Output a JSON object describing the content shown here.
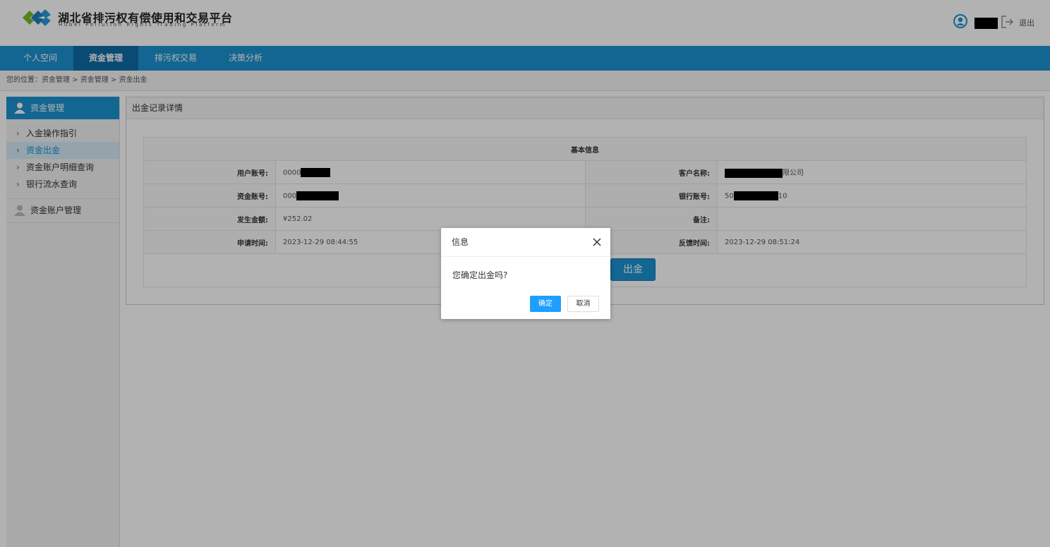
{
  "header": {
    "brand_cn": "湖北省排污权有偿使用和交易平台",
    "brand_en": "Hubei Pollution Rights Trading Platform",
    "logout": "退出"
  },
  "nav": {
    "items": [
      {
        "label": "个人空间"
      },
      {
        "label": "资金管理"
      },
      {
        "label": "排污权交易"
      },
      {
        "label": "决策分析"
      }
    ],
    "active": "资金管理"
  },
  "breadcrumb": {
    "prefix": "您的位置：",
    "path": "资金管理 > 资金管理 > 资金出金"
  },
  "sidebar": {
    "header": "资金管理",
    "items": [
      {
        "label": "入金操作指引"
      },
      {
        "label": "资金出金"
      },
      {
        "label": "资金账户明细查询"
      },
      {
        "label": "银行流水查询"
      }
    ],
    "group2": "资金账户管理"
  },
  "panel": {
    "title": "出金记录详情",
    "section": "基本信息",
    "rows": [
      {
        "k1": "用户账号:",
        "v1_prefix": "0000",
        "k2": "客户名称:",
        "v2_prefix": "",
        "v2_suffix": "限公司"
      },
      {
        "k1": "资金账号:",
        "v1_prefix": "000",
        "k2": "银行账号:",
        "v2_prefix": "50",
        "v2_suffix": "10"
      },
      {
        "k1": "发生金额:",
        "v1_prefix": "¥252.02",
        "k2": "备注:",
        "v2_prefix": "",
        "v2_suffix": ""
      },
      {
        "k1": "申请时间:",
        "v1_prefix": "2023-12-29 08:44:55",
        "k2": "反馈时间:",
        "v2_prefix": "2023-12-29 08:51:24",
        "v2_suffix": ""
      }
    ],
    "button": "出金"
  },
  "modal": {
    "title": "信息",
    "message": "您确定出金吗?",
    "ok": "确定",
    "cancel": "取消"
  },
  "colors": {
    "primary": "#1c93d1",
    "nav_active": "#0f6ca7",
    "ok_button": "#1e9fff"
  }
}
